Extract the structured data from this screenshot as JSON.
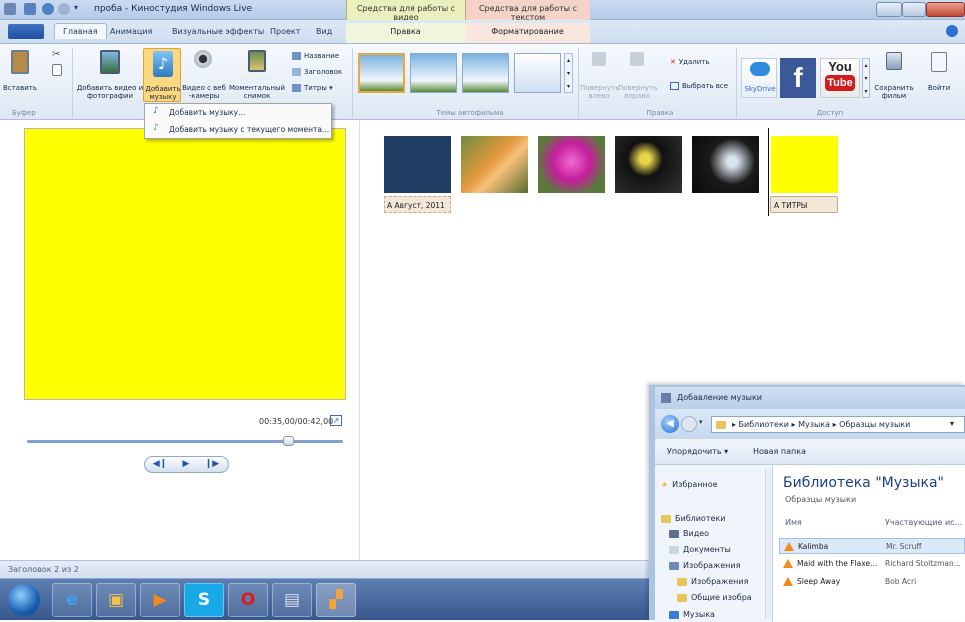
{
  "window": {
    "title": "проба - Киностудия Windows Live",
    "context_video": "Средства для работы с видео",
    "context_text": "Средства для работы с текстом"
  },
  "tabs": {
    "items": [
      "Главная",
      "Анимация",
      "Визуальные эффекты",
      "Проект",
      "Вид"
    ],
    "edit": "Правка",
    "format": "Форматирование"
  },
  "ribbon": {
    "paste": "Вставить",
    "add_video": "Добавить видео и фотографии",
    "add_music": "Добавить музыку",
    "webcam": "Видео с веб -камеры",
    "snapshot": "Моментальный снимок",
    "caption": "Название",
    "heading": "Заголовок",
    "credits": "Титры",
    "rotate_left": "Повернуть влево",
    "rotate_right": "Повернуть вправо",
    "delete": "Удалить",
    "select_all": "Выбрать все",
    "skydrive": "SkyDrive",
    "youtube": "You",
    "youtube_tube": "Tube",
    "save_movie": "Сохранить фильм",
    "sign_in": "Войти",
    "group_buffer": "Буфер",
    "group_themes": "Темы автофильма",
    "group_edit": "Правка",
    "group_access": "Доступ"
  },
  "dropdown": {
    "add_music": "Добавить музыку...",
    "add_music_now": "Добавить музыку с текущего момента..."
  },
  "preview": {
    "timecode": "00:35,00/00:42,00"
  },
  "storyboard": {
    "caption": "A Август, 2011",
    "titles": "A ТИТРЫ"
  },
  "status": {
    "text": "Заголовок 2 из 2"
  },
  "dialog": {
    "title": "Добавление музыки",
    "breadcrumb": "▸ Библиотеки ▸ Музыка ▸ Образцы музыки",
    "organize": "Упорядочить ▾",
    "new_folder": "Новая папка",
    "favorites": "Избранное",
    "libraries": "Библиотеки",
    "video": "Видео",
    "documents": "Документы",
    "images": "Изображения",
    "images_sub": "Изображения",
    "public_images": "Общие изобра",
    "music": "Музыка",
    "library_title": "Библиотека \"Музыка\"",
    "library_sub": "Образцы музыки",
    "col_name": "Имя",
    "col_artist": "Участвующие ис...",
    "files": [
      {
        "name": "Kalimba",
        "artist": "Mr. Scruff"
      },
      {
        "name": "Maid with the Flaxe...",
        "artist": "Richard Stoltzman..."
      },
      {
        "name": "Sleep Away",
        "artist": "Bob Acri"
      }
    ]
  },
  "colors": {
    "accent": "#1f57b0",
    "preview_bg": "#ffff00",
    "titles_bg": "#ffff00"
  }
}
